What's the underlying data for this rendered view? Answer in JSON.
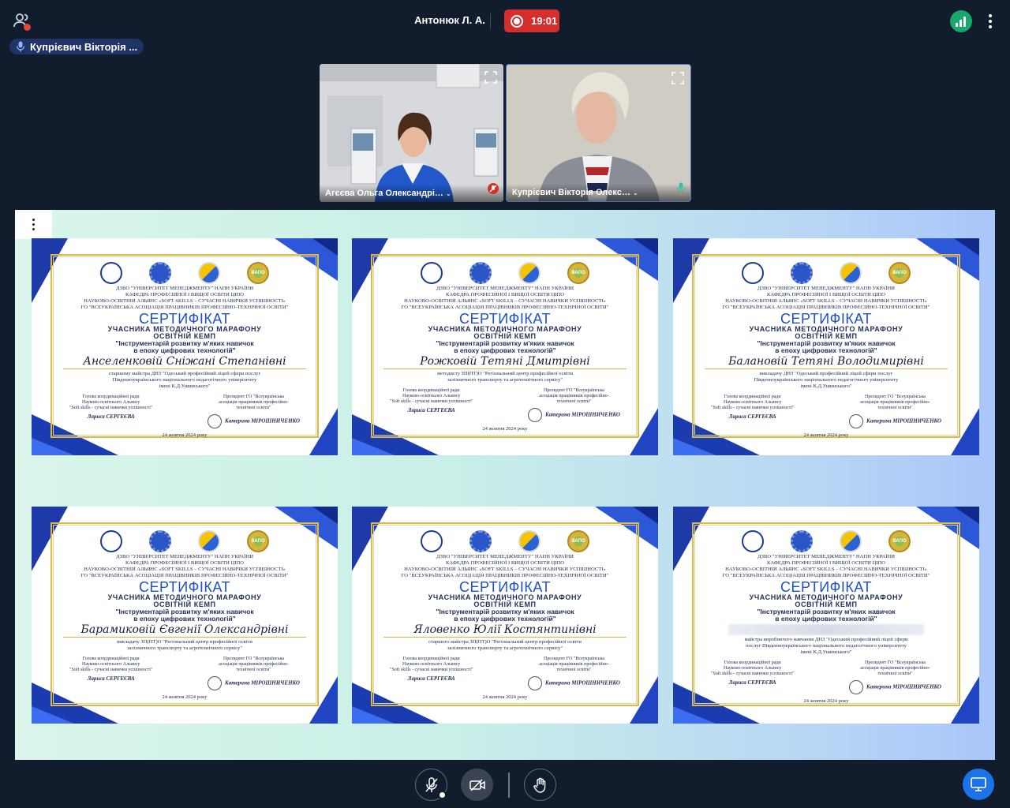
{
  "meeting": {
    "host_name": "Антонюк Л. А.",
    "recording_time": "19:01",
    "active_speaker": "Купрієвич Вікторія ..."
  },
  "participants": [
    {
      "name": "Агєєва Ольга Олександрівна"
    },
    {
      "name": "Купрієвич Вікторія Олександ..."
    }
  ],
  "certificate_template": {
    "org_line_1": "ДЗВО \"УНІВЕРСИТЕТ МЕНЕДЖМЕНТУ\" НАПН УКРАЇНИ",
    "org_line_2": "КАФЕДРА ПРОФЕСІЙНОЇ І ВИЩОЇ ОСВІТИ ЦІПО",
    "org_line_3": "НАУКОВО-ОСВІТНІЙ АЛЬЯНС «SOFT SKILLS – СУЧАСНІ НАВИЧКИ УСПІШНОСТІ»",
    "org_line_4": "ГО \"ВСЕУКРАЇНСЬКА АСОЦІАЦІЯ ПРАЦІВНИКІВ ПРОФЕСІЙНО-ТЕХНІЧНОЇ ОСВІТИ\"",
    "title": "СЕРТИФІКАТ",
    "subtitle_1": "УЧАСНИКА МЕТОДИЧНОГО МАРАФОНУ",
    "subtitle_2": "ОСВІТНІЙ КЕМП",
    "program_1": "\"Інструментарій розвитку м'яких навичок",
    "program_2": "в епоху цифрових технологій\"",
    "badge_logo": "ВАПО",
    "signer_left_role_1": "Голова координаційної ради",
    "signer_left_role_2": "Науково-освітнього Альянсу",
    "signer_left_role_3": "\"Soft skills - сучасні навички успішності\"",
    "signer_left_name": "Лариса СЕРГЕЄВА",
    "signer_right_role_1": "Президент ГО \"Всеукраїнська",
    "signer_right_role_2": "асоціація працівників професійно-",
    "signer_right_role_3": "технічної освіти\"",
    "signer_right_name": "Катерина МІРОШНИЧЕНКО",
    "date": "24 жовтня 2024 року"
  },
  "certificates": [
    {
      "recipient": "Анселенковій Сніжані Степанівні",
      "position_1": "старшому майстра ДНЗ \"Одеський професійний ліцей сфери послуг",
      "position_2": "Південноукраїнського національного педагогічного університету",
      "position_3": "імені К.Д.Ушинського\""
    },
    {
      "recipient": "Рожковій Тетяні Дмитрівні",
      "position_1": "методисту ЗП(ПТ)О \"Регіональний центр професійної освіти",
      "position_2": "залізничного транспорту та агротехнічного сервісу\"",
      "position_3": ""
    },
    {
      "recipient": "Балановій Тетяні Володимирівні",
      "position_1": "викладачу ДНЗ \"Одеський професійний ліцей сфери послуг",
      "position_2": "Південноукраїнського національного педагогічного університету",
      "position_3": "імені К.Д.Ушинського\""
    },
    {
      "recipient": "Барамиковій Євгенії Олександрівні",
      "position_1": "викладачу ЗП(ПТ)О \"Регіональний центр професійної освіти",
      "position_2": "залізничного транспорту та агротехнічного сервісу\"",
      "position_3": ""
    },
    {
      "recipient": "Яловенко Юлії Костянтинівні",
      "position_1": "старшого майстра ЗП(ПТ)О \"Регіональний центр професійної освіти",
      "position_2": "залізничного транспорту та агротехнічного сервісу\"",
      "position_3": ""
    },
    {
      "recipient": "",
      "position_1": "майстра виробничого навчання ДНЗ \"Одеський професійний ліцей сфери",
      "position_2": "послуг Південноукраїнського національного педагогічного університету",
      "position_3": "імені К.Д.Ушинського\""
    }
  ],
  "colors": {
    "background": "#111c2c",
    "record": "#d62d2d",
    "accent": "#1a73e8",
    "connection": "#17a86a",
    "speaker_chip": "#1f3366"
  },
  "icons": {
    "people": "people-icon",
    "record": "record-icon",
    "signal": "signal-bars-icon",
    "more": "more-vert-icon",
    "fullscreen": "fullscreen-icon",
    "mic_on": "mic-icon",
    "mic_off": "mic-off-icon",
    "camera_off": "camera-off-icon",
    "raise_hand": "hand-icon",
    "present": "present-screen-icon"
  }
}
